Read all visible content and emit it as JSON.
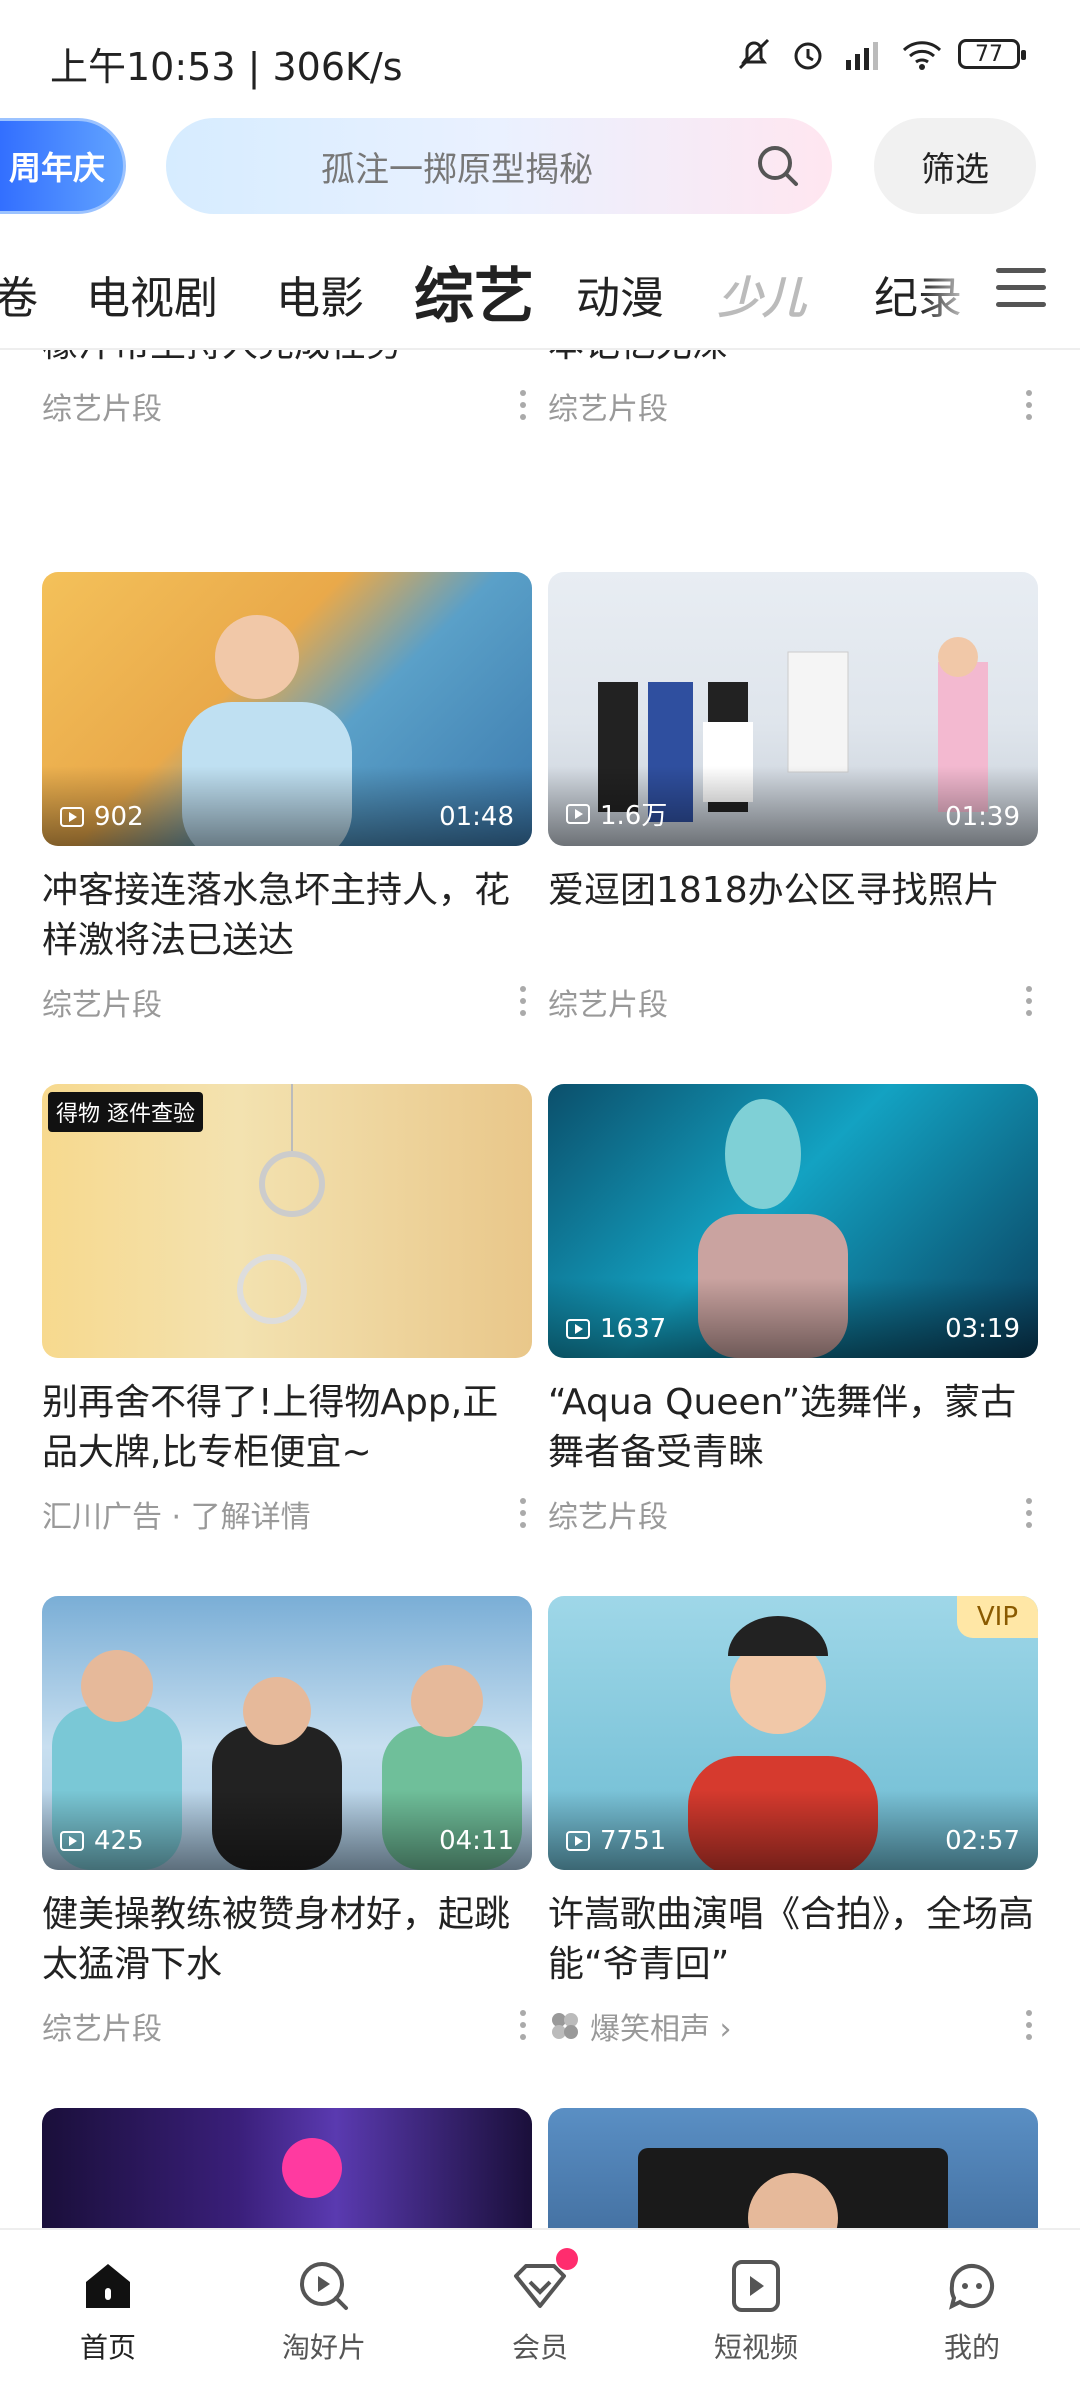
{
  "status_bar": {
    "time": "上午10:53 | 306K/s",
    "battery": "77"
  },
  "top_bar": {
    "promo_label": "周年庆",
    "search_placeholder": "孤注一掷原型揭秘",
    "filter_label": "筛选"
  },
  "tabs": [
    {
      "label": "卷",
      "active": false
    },
    {
      "label": "电视剧",
      "active": false
    },
    {
      "label": "电影",
      "active": false
    },
    {
      "label": "综艺",
      "active": true
    },
    {
      "label": "动漫",
      "active": false
    },
    {
      "label": "少儿",
      "active": false
    },
    {
      "label": "纪录",
      "active": false
    }
  ],
  "feed": {
    "row0": [
      {
        "title": "杨秀丽闯关失败，勇敢尝试柠檬汁帮主持人完成任务",
        "meta": "综艺片段"
      },
      {
        "title": "车晓回忆母亲的礼物，蝴蝶标本记忆尤深",
        "meta": "综艺片段"
      }
    ],
    "row1": [
      {
        "views": "902",
        "duration": "01:48",
        "title": "冲客接连落水急坏主持人，花样激将法已送达",
        "meta": "综艺片段"
      },
      {
        "views": "1.6万",
        "duration": "01:39",
        "title": "爱逗团1818办公区寻找照片",
        "meta": "综艺片段"
      }
    ],
    "row2": [
      {
        "ad_badge": "得物 逐件查验",
        "title": "别再舍不得了!上得物App,正品大牌,比专柜便宜~",
        "meta": "汇川广告 · 了解详情"
      },
      {
        "views": "1637",
        "duration": "03:19",
        "title": "“Aqua Queen”选舞伴，蒙古舞者备受青睐",
        "meta": "综艺片段"
      }
    ],
    "row3": [
      {
        "views": "425",
        "duration": "04:11",
        "title": "健美操教练被赞身材好，起跳太猛滑下水",
        "meta": "综艺片段"
      },
      {
        "views": "7751",
        "duration": "02:57",
        "vip": "VIP",
        "title": "许嵩歌曲演唱《合拍》，全场高能“爷青回”",
        "meta": "爆笑相声 ›"
      }
    ]
  },
  "bottom_nav": [
    {
      "label": "首页",
      "icon": "home-icon",
      "active": true
    },
    {
      "label": "淘好片",
      "icon": "discover-icon",
      "active": false
    },
    {
      "label": "会员",
      "icon": "vip-diamond-icon",
      "active": false
    },
    {
      "label": "短视频",
      "icon": "short-video-icon",
      "active": false
    },
    {
      "label": "我的",
      "icon": "profile-icon",
      "active": false
    }
  ],
  "colors": {
    "accent_pink": "#ff2d6e",
    "promo_blue": "#2f6bff",
    "vip_gold": "#ffe7a6"
  }
}
